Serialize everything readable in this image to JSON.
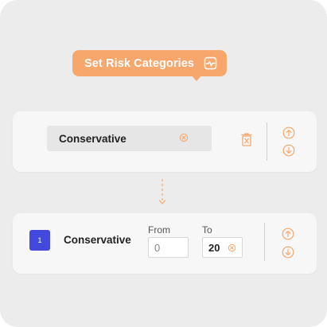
{
  "tooltip": {
    "label": "Set Risk Categories",
    "icon": "activity-chart-icon"
  },
  "editor": {
    "category_value": "Conservative",
    "clear_icon": "clear-circle-icon",
    "delete_icon": "trash-icon",
    "move_up_icon": "arrow-up-circle-icon",
    "move_down_icon": "arrow-down-circle-icon"
  },
  "connector_icon": "dashed-arrow-down-icon",
  "range_row": {
    "index": "1",
    "category_name": "Conservative",
    "from_label": "From",
    "from_value": "0",
    "to_label": "To",
    "to_value": "20",
    "move_up_icon": "arrow-up-circle-icon",
    "move_down_icon": "arrow-down-circle-icon"
  },
  "colors": {
    "accent": "#f7a76c",
    "badge": "#4249dc",
    "background": "#ececec",
    "card": "#f7f7f7"
  }
}
